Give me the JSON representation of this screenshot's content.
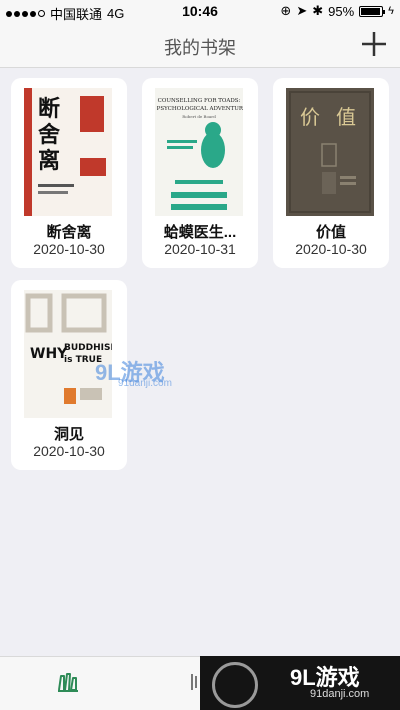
{
  "status_bar": {
    "carrier": "中国联通",
    "network": "4G",
    "time": "10:46",
    "battery": "95%",
    "battery_level": 0.95
  },
  "nav": {
    "title": "我的书架",
    "add_icon": "plus-icon"
  },
  "books": [
    {
      "title": "断舍离",
      "date": "2020-10-30",
      "cover_text": "断舍离"
    },
    {
      "title": "蛤蟆医生...",
      "date": "2020-10-31",
      "cover_text": "COUNSELLING FOR TOADS: A PSYCHOLOGICAL ADVENTURE"
    },
    {
      "title": "价值",
      "date": "2020-10-30",
      "cover_text": "价值"
    },
    {
      "title": "洞见",
      "date": "2020-10-30",
      "cover_text": "WHY BUDDHISM is TRUE"
    }
  ],
  "tabs": [
    {
      "icon": "bookshelf-icon",
      "active": true
    },
    {
      "icon": "book-icon",
      "active": false
    }
  ],
  "watermark": {
    "logo": "9L游戏",
    "url": "91danji.com"
  },
  "colors": {
    "active_tab": "#2e8b57",
    "background": "#efeff4"
  }
}
